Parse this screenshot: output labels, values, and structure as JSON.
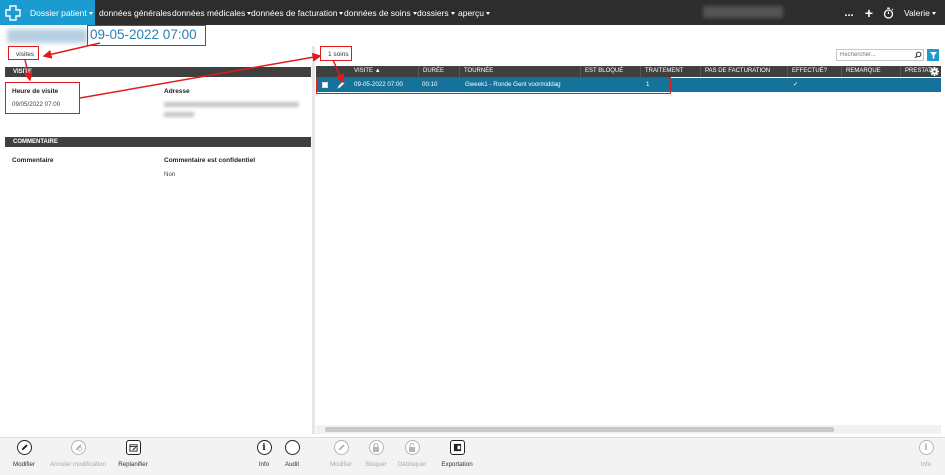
{
  "nav": {
    "patient_menu": "Dossier patient",
    "items": [
      "données générales",
      "données médicales",
      "données de facturation",
      "données de soins",
      "dossiers",
      "aperçu"
    ],
    "more": "...",
    "add": "+",
    "user": "Valerie"
  },
  "page": {
    "title": "09-05-2022 07:00"
  },
  "left": {
    "tab_label": "visites",
    "visit_section": "VISITE",
    "visit_time_label": "Heure de visite",
    "visit_time_value": "09/05/2022 07:00",
    "address_label": "Adresse",
    "comment_section": "COMMENTAIRE",
    "comment_label": "Commentaire",
    "confidential_label": "Commentaire est confidentiel",
    "confidential_value": "Non"
  },
  "right": {
    "tab_label": "1 soins",
    "search_placeholder": "Rechercher...",
    "columns": [
      "VISITE",
      "DURÉE",
      "TOURNÉE",
      "EST BLOQUÉ",
      "TRAITEMENT",
      "PAS DE FACTURATION",
      "EFFECTUÉ?",
      "REMARQUE",
      "PRESTAT"
    ],
    "sort_indicator": "▲",
    "row": {
      "visite": "09-05-2022 07:00",
      "duree": "00:10",
      "tournee": "Gweek1 - Ronde Gent voormiddag",
      "est_bloque": "",
      "traitement": "1",
      "pas_de_facturation": "",
      "effectue": "✓",
      "remarque": ""
    }
  },
  "toolbar": {
    "modifier": "Modifier",
    "annuler_modification": "Annuler modification",
    "replanifier": "Replanifier",
    "info": "Info",
    "audit": "Audit",
    "modifier2": "Modifier",
    "bloquer": "Bloquer",
    "debloquer": "Débloquer",
    "exportation": "Exportation",
    "info2": "Info"
  },
  "colors": {
    "accent": "#1a9cd0",
    "nav_bg": "#2d2d2d",
    "row_selected": "#14729b",
    "annotation": "#e01b1b"
  }
}
